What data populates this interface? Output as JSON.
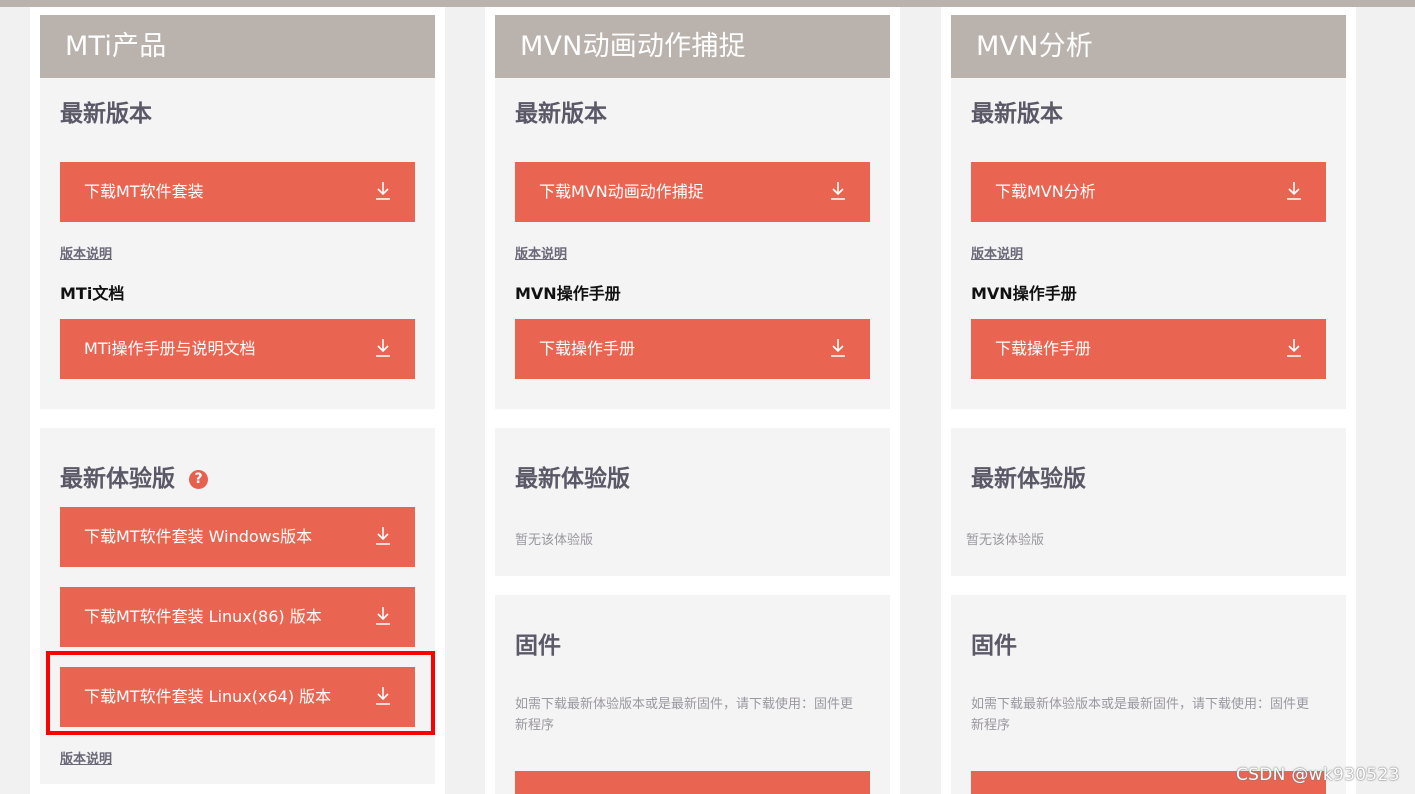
{
  "columns": [
    {
      "header": "MTi产品",
      "latest": {
        "title": "最新版本",
        "download_label": "下载MT软件套装",
        "notes_link": "版本说明",
        "doc_title": "MTi文档",
        "doc_button": "MTi操作手册与说明文档"
      },
      "beta": {
        "title": "最新体验版",
        "help_icon": "?",
        "buttons": [
          "下载MT软件套装 Windows版本",
          "下载MT软件套装 Linux(86) 版本",
          "下载MT软件套装 Linux(x64) 版本"
        ],
        "notes_link": "版本说明"
      }
    },
    {
      "header": "MVN动画动作捕捉",
      "latest": {
        "title": "最新版本",
        "download_label": "下载MVN动画动作捕捉",
        "notes_link": "版本说明",
        "doc_title": "MVN操作手册",
        "doc_button": "下载操作手册"
      },
      "beta": {
        "title": "最新体验版",
        "empty_text": "暂无该体验版"
      },
      "firmware": {
        "title": "固件",
        "description": "如需下载最新体验版本或是最新固件，请下载使用：固件更新程序"
      }
    },
    {
      "header": "MVN分析",
      "latest": {
        "title": "最新版本",
        "download_label": "下载MVN分析",
        "notes_link": "版本说明",
        "doc_title": "MVN操作手册",
        "doc_button": "下载操作手册"
      },
      "beta": {
        "title": "最新体验版",
        "empty_text": "暂无该体验版"
      },
      "firmware": {
        "title": "固件",
        "description": "如需下载最新体验版本或是最新固件，请下载使用：固件更新程序"
      }
    }
  ],
  "watermark": "CSDN @wk930523",
  "colors": {
    "header_bg": "#bab2ac",
    "button_bg": "#ea6551",
    "card_bg": "#f4f4f4",
    "title_text": "#5b5867",
    "highlight": "#ff0000"
  }
}
